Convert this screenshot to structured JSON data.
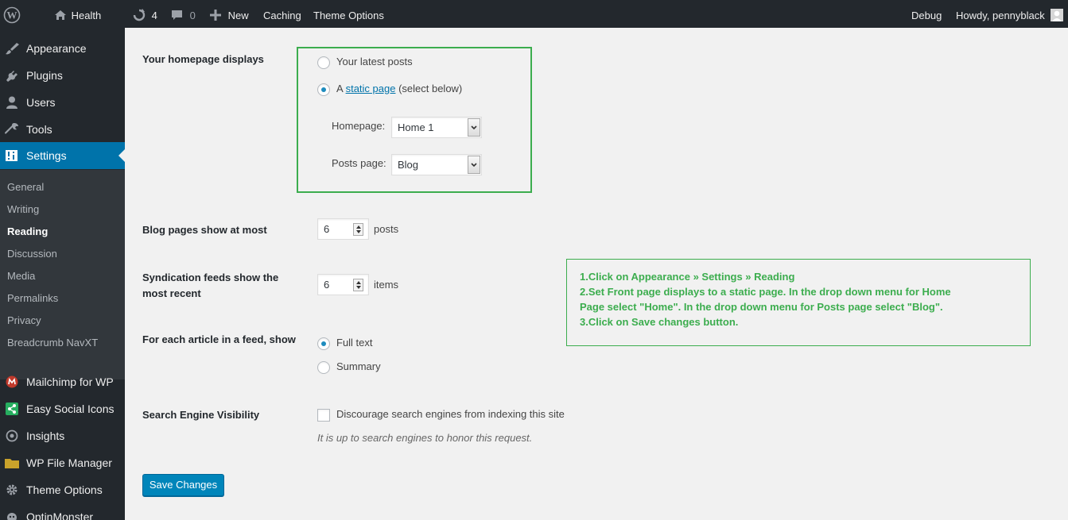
{
  "admin_bar": {
    "site_name": "Health",
    "updates_count": "4",
    "comments_count": "0",
    "new_label": "New",
    "caching_label": "Caching",
    "theme_options_label": "Theme Options",
    "debug_label": "Debug",
    "howdy_label": "Howdy, pennyblack"
  },
  "sidebar": {
    "items": [
      {
        "label": "Appearance",
        "icon": "paintbrush-icon"
      },
      {
        "label": "Plugins",
        "icon": "plug-icon"
      },
      {
        "label": "Users",
        "icon": "user-icon"
      },
      {
        "label": "Tools",
        "icon": "wrench-icon"
      },
      {
        "label": "Settings",
        "icon": "settings-icon"
      }
    ],
    "submenu": [
      "General",
      "Writing",
      "Reading",
      "Discussion",
      "Media",
      "Permalinks",
      "Privacy",
      "Breadcrumb NavXT"
    ],
    "current_submenu": "Reading",
    "plugin_items": [
      {
        "label": "Mailchimp for WP",
        "icon": "mailchimp-icon"
      },
      {
        "label": "Easy Social Icons",
        "icon": "share-icon"
      },
      {
        "label": "Insights",
        "icon": "insights-icon"
      },
      {
        "label": "WP File Manager",
        "icon": "folder-icon"
      },
      {
        "label": "Theme Options",
        "icon": "gear-icon"
      },
      {
        "label": "OptinMonster",
        "icon": "optinmonster-icon"
      }
    ]
  },
  "form": {
    "homepage_displays": {
      "label": "Your homepage displays",
      "option_latest": "Your latest posts",
      "option_static_prefix": "A ",
      "option_static_link": "static page",
      "option_static_suffix": " (select below)",
      "selected": "static page",
      "homepage_label": "Homepage:",
      "homepage_value": "Home 1",
      "posts_page_label": "Posts page:",
      "posts_page_value": "Blog"
    },
    "blog_pages": {
      "label": "Blog pages show at most",
      "value": "6",
      "unit": "posts"
    },
    "syndication": {
      "label_line1": "Syndication feeds show the",
      "label_line2": "most recent",
      "value": "6",
      "unit": "items"
    },
    "feed_article": {
      "label": "For each article in a feed, show",
      "option_full": "Full text",
      "option_summary": "Summary",
      "selected": "Full text"
    },
    "search_visibility": {
      "label": "Search Engine Visibility",
      "checkbox_label": "Discourage search engines from indexing this site",
      "checked": false,
      "hint": "It is up to search engines to honor this request."
    },
    "save_label": "Save Changes"
  },
  "note": {
    "lines": [
      "1.Click on Appearance » Settings » Reading",
      "2.Set Front page displays to a static page. In the drop down menu for Home",
      "Page select \"Home\". In the drop down menu for Posts page select \"Blog\".",
      "3.Click on Save changes button."
    ]
  },
  "colors": {
    "accent": "#0073aa",
    "highlight": "#3cad4e",
    "adminbar": "#23282d"
  }
}
